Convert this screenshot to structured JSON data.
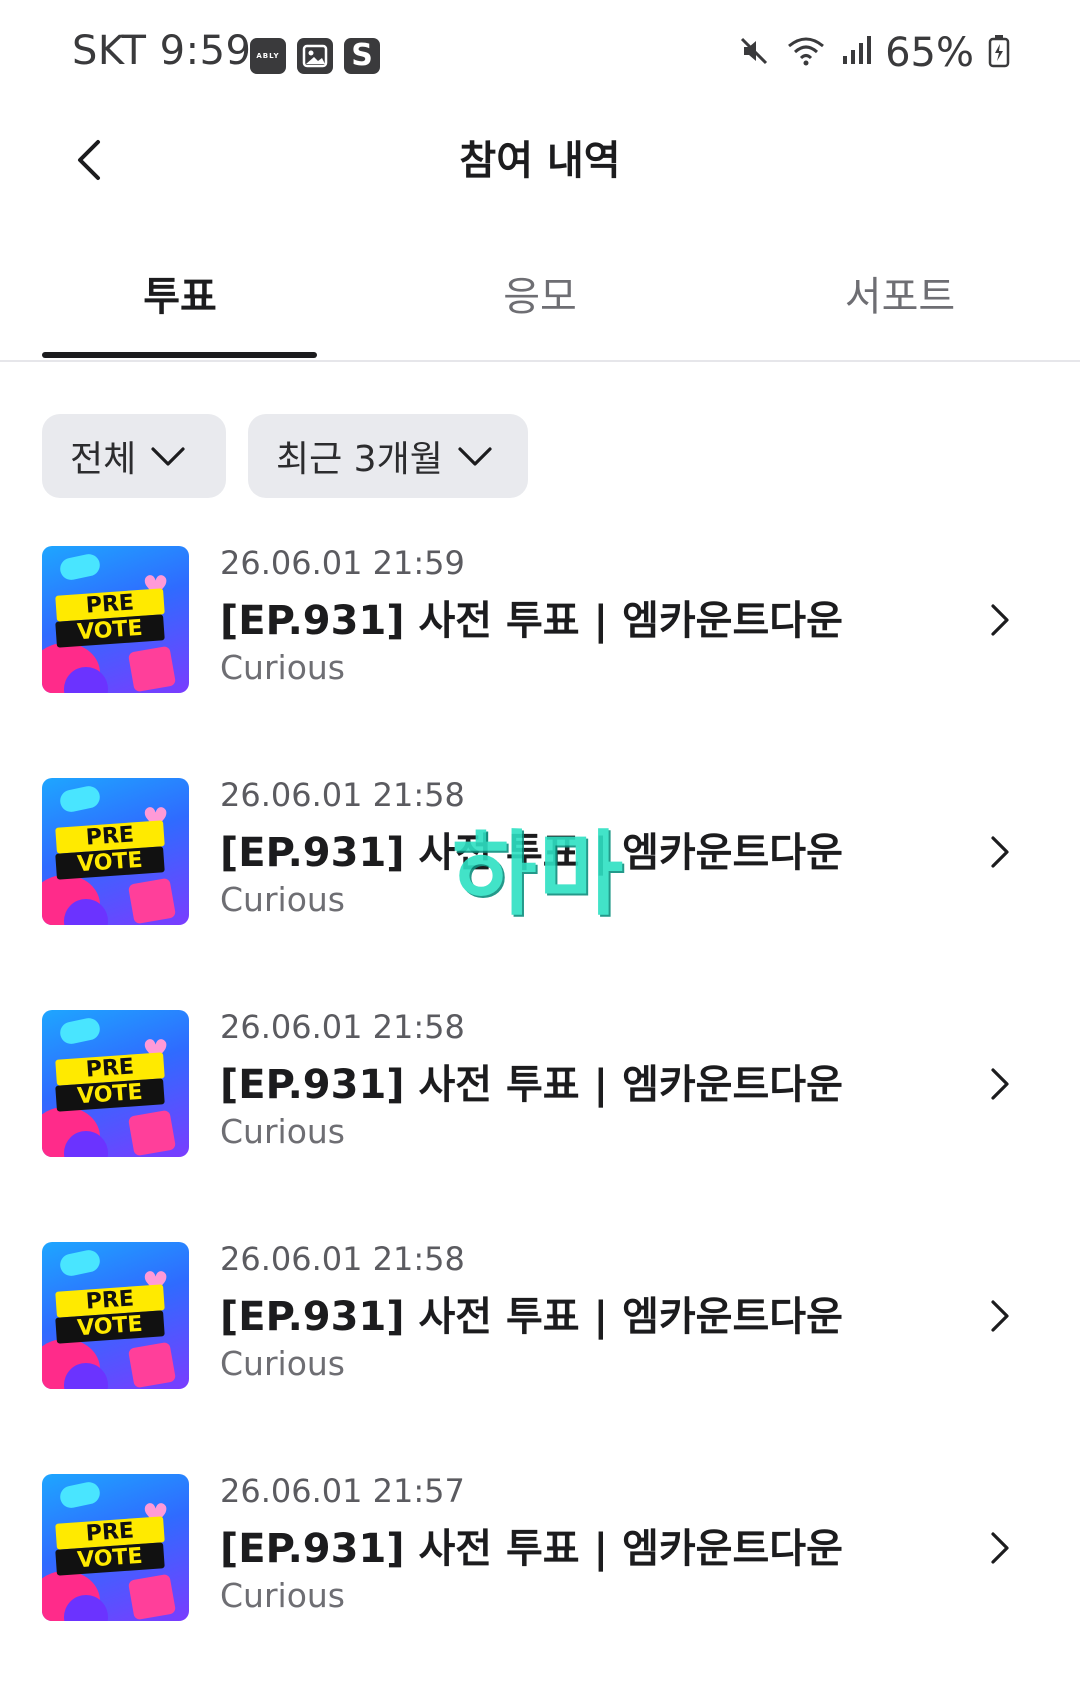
{
  "status_bar": {
    "carrier_time": "SKT 9:59",
    "app_icon_ably": "ABLY",
    "app_icon_gallery": "gallery-icon",
    "app_icon_s": "S",
    "battery": "65%",
    "icons": [
      "mute-icon",
      "wifi-icon",
      "signal-icon",
      "battery-charging-icon"
    ]
  },
  "header": {
    "title": "참여 내역",
    "back_icon": "chevron-left-icon"
  },
  "tabs": [
    {
      "label": "투표",
      "active": true
    },
    {
      "label": "응모",
      "active": false
    },
    {
      "label": "서포트",
      "active": false
    }
  ],
  "filters": {
    "type": "전체",
    "period": "최근 3개월"
  },
  "items": [
    {
      "date": "26.06.01 21:59",
      "title": "[EP.931] 사전 투표 | 엠카운트다운",
      "subtitle": "Curious",
      "thumb_top": "PRE",
      "thumb_bottom": "VOTE"
    },
    {
      "date": "26.06.01 21:58",
      "title": "[EP.931] 사전 투표 | 엠카운트다운",
      "subtitle": "Curious",
      "thumb_top": "PRE",
      "thumb_bottom": "VOTE"
    },
    {
      "date": "26.06.01 21:58",
      "title": "[EP.931] 사전 투표 | 엠카운트다운",
      "subtitle": "Curious",
      "thumb_top": "PRE",
      "thumb_bottom": "VOTE"
    },
    {
      "date": "26.06.01 21:58",
      "title": "[EP.931] 사전 투표 | 엠카운트다운",
      "subtitle": "Curious",
      "thumb_top": "PRE",
      "thumb_bottom": "VOTE"
    },
    {
      "date": "26.06.01 21:57",
      "title": "[EP.931] 사전 투표 | 엠카운트다운",
      "subtitle": "Curious",
      "thumb_top": "PRE",
      "thumb_bottom": "VOTE"
    }
  ],
  "watermark": "하마",
  "colors": {
    "active_tab": "#1c1c1e",
    "filter_bg": "#e9eaee",
    "watermark": "#2ee0c3"
  }
}
